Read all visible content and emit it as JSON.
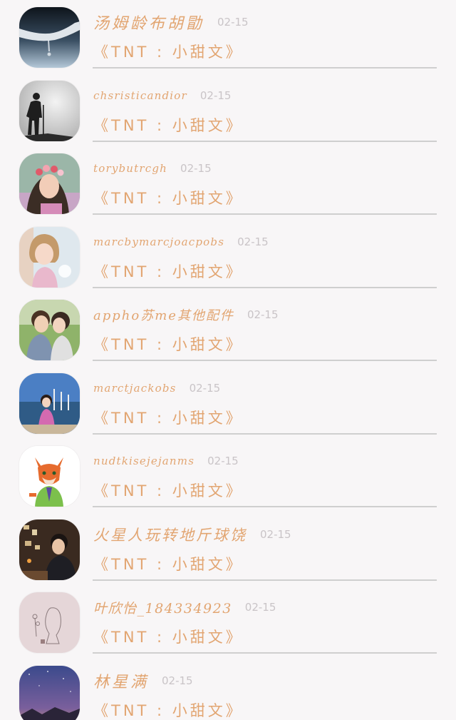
{
  "messages": [
    {
      "name": "汤姆龄布胡勖",
      "date": "02-15",
      "subtitle": "《TNT : 小甜文》",
      "avatar": "hand-water-avatar"
    },
    {
      "name": "chsristicandior",
      "date": "02-15",
      "subtitle": "《TNT : 小甜文》",
      "avatar": "hiker-silhouette-avatar"
    },
    {
      "name": "torybutrcgh",
      "date": "02-15",
      "subtitle": "《TNT : 小甜文》",
      "avatar": "flower-crown-girl-avatar"
    },
    {
      "name": "marcbymarcjoacpobs",
      "date": "02-15",
      "subtitle": "《TNT : 小甜文》",
      "avatar": "little-girl-avatar"
    },
    {
      "name": "appho苏me其他配件",
      "date": "02-15",
      "subtitle": "《TNT : 小甜文》",
      "avatar": "couple-avatar"
    },
    {
      "name": "marctjackobs",
      "date": "02-15",
      "subtitle": "《TNT : 小甜文》",
      "avatar": "harbor-girl-avatar"
    },
    {
      "name": "nudtkisejejanms",
      "date": "02-15",
      "subtitle": "《TNT : 小甜文》",
      "avatar": "cartoon-fox-avatar"
    },
    {
      "name": "火星人玩转地斤球饶",
      "date": "02-15",
      "subtitle": "《TNT : 小甜文》",
      "avatar": "man-cafe-avatar"
    },
    {
      "name": "叶欣怡_184334923",
      "date": "02-15",
      "subtitle": "《TNT : 小甜文》",
      "avatar": "sketch-girl-avatar"
    },
    {
      "name": "林星满",
      "date": "02-15",
      "subtitle": "《TNT : 小甜文》",
      "avatar": "starry-sky-avatar"
    }
  ],
  "colors": {
    "name": "#e2a571",
    "date": "#c9c4c7",
    "divider": "#cfcfcf",
    "background": "#f8f6f7"
  }
}
